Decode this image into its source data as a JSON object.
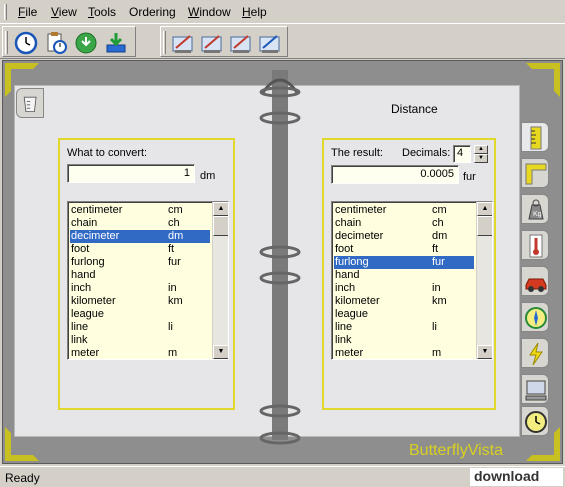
{
  "menu": [
    {
      "key": "F",
      "rest": "ile"
    },
    {
      "key": "V",
      "rest": "iew"
    },
    {
      "key": "T",
      "rest": "ools"
    },
    {
      "key": "",
      "rest": "Ordering"
    },
    {
      "key": "W",
      "rest": "indow"
    },
    {
      "key": "H",
      "rest": "elp"
    }
  ],
  "toolbar": {
    "group1_icons": [
      "clock-icon",
      "timer-clipboard-icon",
      "update-globe-icon",
      "download-icon"
    ],
    "group2_icons": [
      "converter-icon-1",
      "converter-icon-2",
      "converter-icon-3",
      "converter-icon-4"
    ]
  },
  "category": "Distance",
  "left": {
    "label": "What to convert:",
    "value": "1",
    "unit": "dm",
    "units": [
      {
        "name": "centimeter",
        "abbr": "cm"
      },
      {
        "name": "chain",
        "abbr": "ch"
      },
      {
        "name": "decimeter",
        "abbr": "dm",
        "selected": true
      },
      {
        "name": "foot",
        "abbr": "ft"
      },
      {
        "name": "furlong",
        "abbr": "fur"
      },
      {
        "name": "hand",
        "abbr": ""
      },
      {
        "name": "inch",
        "abbr": "in"
      },
      {
        "name": "kilometer",
        "abbr": "km"
      },
      {
        "name": "league",
        "abbr": ""
      },
      {
        "name": "line",
        "abbr": "li"
      },
      {
        "name": "link",
        "abbr": ""
      },
      {
        "name": "meter",
        "abbr": "m"
      }
    ]
  },
  "right": {
    "label": "The result:",
    "decimals_label": "Decimals:",
    "decimals_value": "4",
    "value": "0.0005",
    "unit": "fur",
    "units": [
      {
        "name": "centimeter",
        "abbr": "cm"
      },
      {
        "name": "chain",
        "abbr": "ch"
      },
      {
        "name": "decimeter",
        "abbr": "dm"
      },
      {
        "name": "foot",
        "abbr": "ft"
      },
      {
        "name": "furlong",
        "abbr": "fur",
        "selected": true
      },
      {
        "name": "hand",
        "abbr": ""
      },
      {
        "name": "inch",
        "abbr": "in"
      },
      {
        "name": "kilometer",
        "abbr": "km"
      },
      {
        "name": "league",
        "abbr": ""
      },
      {
        "name": "line",
        "abbr": "li"
      },
      {
        "name": "link",
        "abbr": ""
      },
      {
        "name": "meter",
        "abbr": "m"
      }
    ]
  },
  "side_tabs": [
    "ruler-icon",
    "area-icon",
    "weight-icon",
    "thermometer-icon",
    "car-speed-icon",
    "compass-icon",
    "energy-icon",
    "computer-icon",
    "clock-icon"
  ],
  "brand": "ButterflyVista",
  "status": "Ready",
  "watermark": "download"
}
